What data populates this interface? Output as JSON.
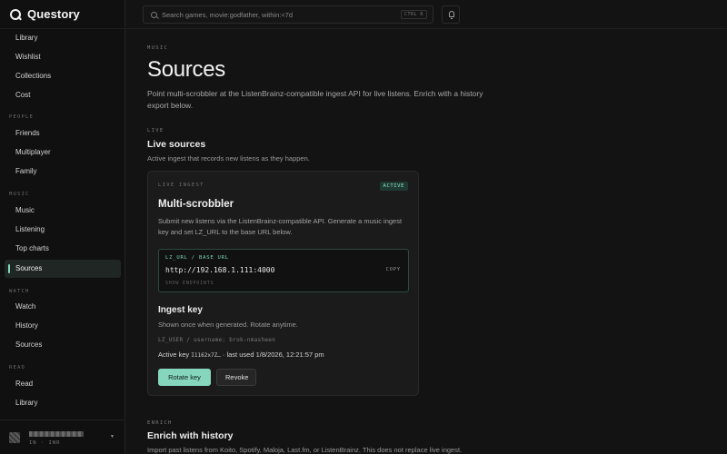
{
  "app": {
    "name": "Questory"
  },
  "search": {
    "placeholder": "Search games, movie:godfather, within:<7d",
    "shortcut": "CTRL K"
  },
  "sidebar": {
    "top_items": [
      {
        "label": "Library"
      },
      {
        "label": "Wishlist"
      },
      {
        "label": "Collections"
      },
      {
        "label": "Cost"
      }
    ],
    "sections": [
      {
        "label": "PEOPLE",
        "items": [
          {
            "label": "Friends"
          },
          {
            "label": "Multiplayer"
          },
          {
            "label": "Family"
          }
        ]
      },
      {
        "label": "MUSIC",
        "items": [
          {
            "label": "Music"
          },
          {
            "label": "Listening"
          },
          {
            "label": "Top charts"
          },
          {
            "label": "Sources",
            "active": true
          }
        ]
      },
      {
        "label": "WATCH",
        "items": [
          {
            "label": "Watch"
          },
          {
            "label": "History"
          },
          {
            "label": "Sources"
          }
        ]
      },
      {
        "label": "READ",
        "items": [
          {
            "label": "Read"
          },
          {
            "label": "Library"
          }
        ]
      }
    ],
    "account": {
      "sub": "IN · INR"
    }
  },
  "page": {
    "eyebrow": "MUSIC",
    "title": "Sources",
    "lede": "Point multi-scrobbler at the ListenBrainz-compatible ingest API for live listens. Enrich with a history export below.",
    "live": {
      "eyebrow": "LIVE",
      "title": "Live sources",
      "desc": "Active ingest that records new listens as they happen."
    },
    "card": {
      "eyebrow": "LIVE INGEST",
      "badge": "ACTIVE",
      "title": "Multi-scrobbler",
      "desc": "Submit new listens via the ListenBrainz-compatible API. Generate a music ingest key and set LZ_URL to the base URL below.",
      "url_label": "LZ_URL / BASE URL",
      "url_value": "http://192.168.1.111:4000",
      "copy_label": "COPY",
      "endpoints_label": "SHOW ENDPOINTS",
      "ingest_title": "Ingest key",
      "ingest_desc": "Shown once when generated. Rotate anytime.",
      "user_line": "LZ_USER / username: brok-nmasheen",
      "active_key_label": "Active key",
      "active_key_value": "I1162x7Z…",
      "last_used": "· last used 1/8/2026, 12:21:57 pm",
      "rotate_label": "Rotate key",
      "revoke_label": "Revoke"
    },
    "enrich": {
      "eyebrow": "ENRICH",
      "title": "Enrich with history",
      "desc": "Import past listens from Koito, Spotify, Maloja, Last.fm, or ListenBrainz. This does not replace live ingest."
    }
  }
}
